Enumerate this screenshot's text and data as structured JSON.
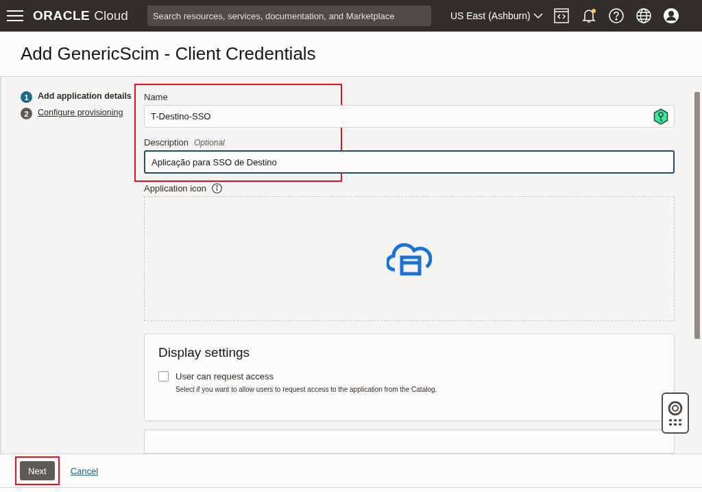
{
  "header": {
    "brand": "ORACLE",
    "product": "Cloud",
    "search": {
      "placeholder": "Search resources, services, documentation, and Marketplace"
    },
    "region": "US East (Ashburn)",
    "notification_badge": true
  },
  "page": {
    "title": "Add GenericScim - Client Credentials"
  },
  "steps": [
    {
      "number": "1",
      "label": "Add application details",
      "selected": true
    },
    {
      "number": "2",
      "label": "Configure provisioning",
      "selected": false
    }
  ],
  "form": {
    "name": {
      "label": "Name",
      "value": "T-Destino-SSO"
    },
    "description": {
      "label": "Description",
      "optional": "Optional",
      "value": "Aplicação para SSO de Destino",
      "focused": true
    },
    "application_icon": {
      "label": "Application icon"
    },
    "display_settings": {
      "title": "Display settings",
      "checkbox": {
        "label": "User can request access",
        "checked": false,
        "help": "Select if you want to allow users to request access to the application from the Catalog."
      }
    }
  },
  "footer": {
    "buttons": [
      {
        "kind": "primary",
        "label": "Next"
      },
      {
        "kind": "link",
        "label": "Cancel"
      }
    ]
  }
}
